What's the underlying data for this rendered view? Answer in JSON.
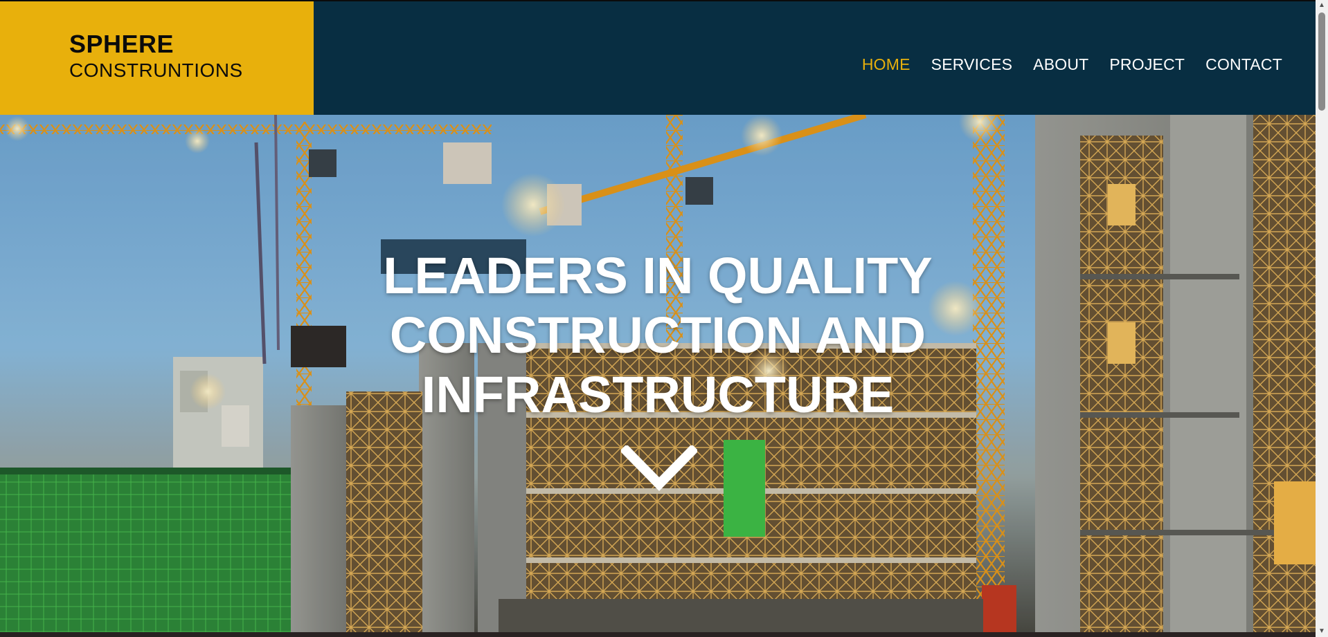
{
  "brand": {
    "name": "SPHERE",
    "sub": "CONSTRUNTIONS"
  },
  "nav": {
    "items": [
      {
        "label": "HOME",
        "active": true
      },
      {
        "label": "SERVICES",
        "active": false
      },
      {
        "label": "ABOUT",
        "active": false
      },
      {
        "label": "PROJECT",
        "active": false
      },
      {
        "label": "CONTACT",
        "active": false
      }
    ]
  },
  "hero": {
    "title_lines": [
      "LEADERS IN QUALITY",
      "CONSTRUCTION AND",
      "INFRASTRUCTURE"
    ],
    "scroll_icon": "chevron-down-icon",
    "background": "construction site with tower cranes and scaffolding"
  },
  "colors": {
    "accent": "#e8b00c",
    "header_bg": "#082e42",
    "text_light": "#ffffff"
  }
}
